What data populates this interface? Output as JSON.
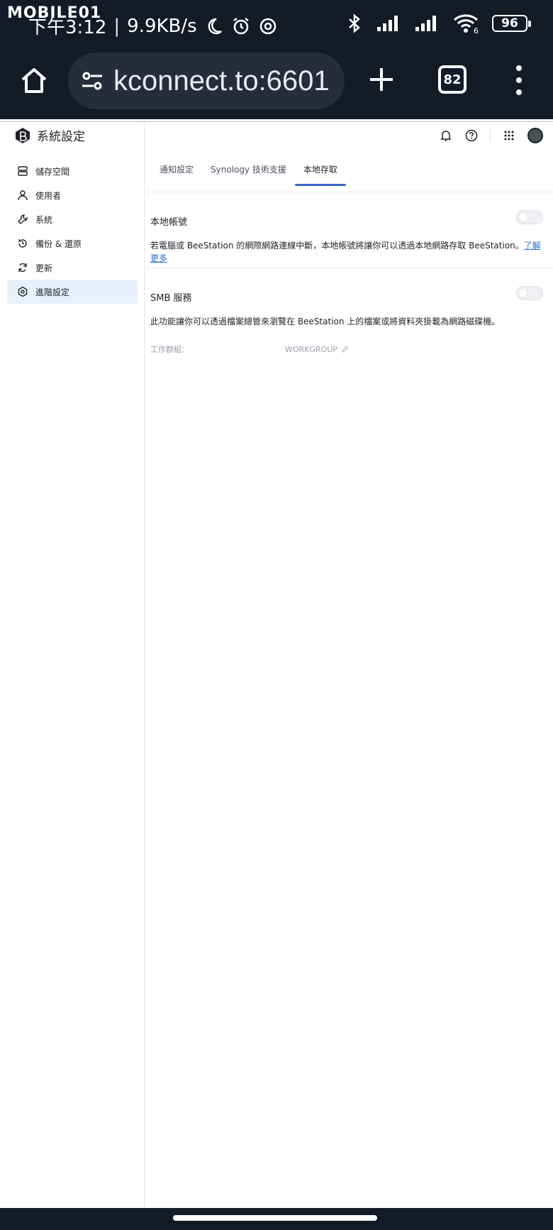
{
  "status_bar": {
    "watermark": "MOBILE01",
    "time": "下午3:12",
    "net_speed": "9.9KB/s",
    "battery": "96",
    "wifi_tag": "6"
  },
  "browser": {
    "url": "kconnect.to:6601",
    "tab_count": "82"
  },
  "app": {
    "title": "系統設定",
    "nav": [
      {
        "label": "儲存空間",
        "icon": "storage-icon"
      },
      {
        "label": "使用者",
        "icon": "user-icon"
      },
      {
        "label": "系統",
        "icon": "wrench-icon"
      },
      {
        "label": "備份 & 還原",
        "icon": "backup-icon"
      },
      {
        "label": "更新",
        "icon": "update-icon"
      },
      {
        "label": "進階設定",
        "icon": "advanced-icon",
        "active": true
      }
    ],
    "tabs": [
      {
        "label": "通知設定"
      },
      {
        "label": "Synology 技術支援"
      },
      {
        "label": "本地存取",
        "active": true
      }
    ],
    "local_account": {
      "title": "本地帳號",
      "desc": "若電腦或 BeeStation 的網際網路連線中斷，本地帳號將讓你可以透過本地網路存取 BeeStation。",
      "link": "了解更多",
      "enabled": false
    },
    "smb": {
      "title": "SMB 服務",
      "desc": "此功能讓你可以透過檔案總管來瀏覽在 BeeStation 上的檔案或將資料夾掛載為網路磁碟機。",
      "workgroup_label": "工作群組：",
      "workgroup_value": "WORKGROUP",
      "enabled": false
    }
  },
  "colors": {
    "status_bg": "#141a26",
    "accent": "#3b67c9",
    "active_nav_bg": "#e8f0fb",
    "link": "#2c6fd6"
  }
}
